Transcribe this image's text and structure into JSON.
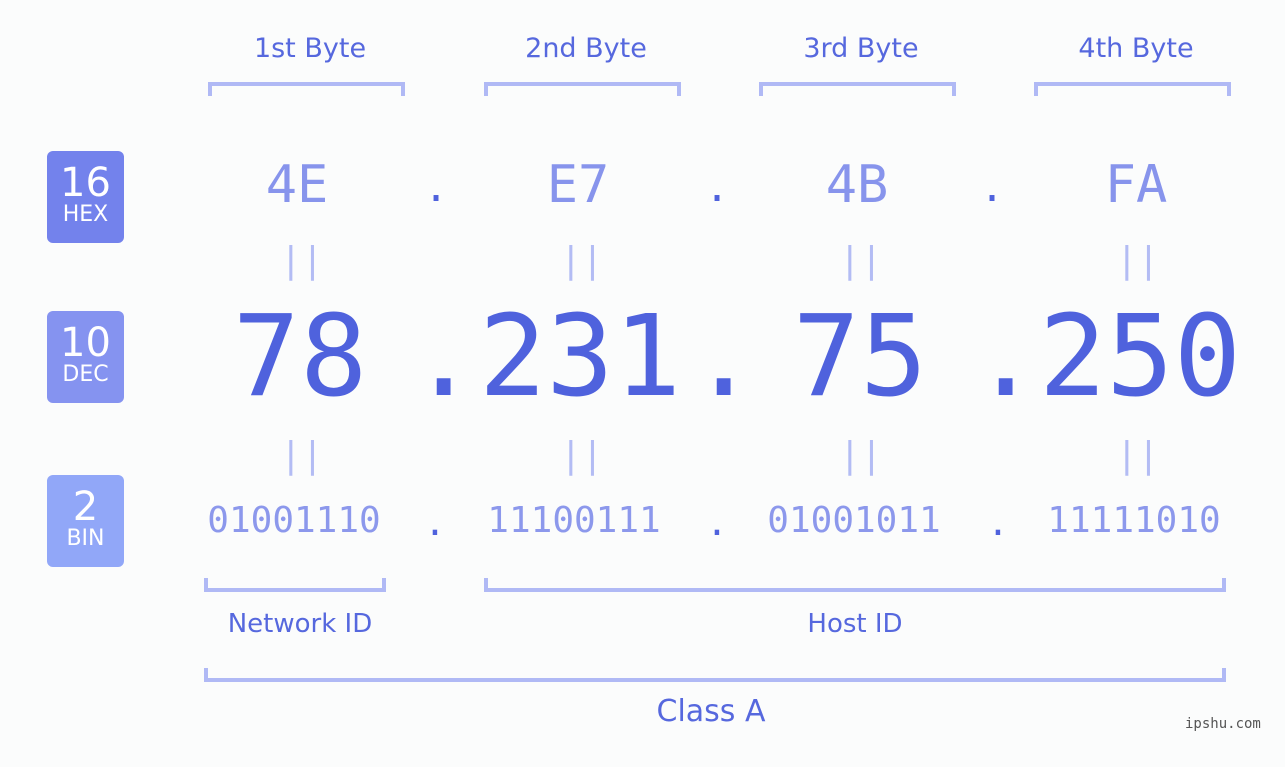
{
  "badges": [
    {
      "num": "16",
      "label": "HEX",
      "color": "#7382ec"
    },
    {
      "num": "10",
      "label": "DEC",
      "color": "#8593f0"
    },
    {
      "num": "2",
      "label": "BIN",
      "color": "#91a7f8"
    }
  ],
  "bytes": [
    {
      "label": "1st Byte",
      "hex": "4E",
      "dec": "78",
      "bin": "01001110"
    },
    {
      "label": "2nd Byte",
      "hex": "E7",
      "dec": "231",
      "bin": "11100111"
    },
    {
      "label": "3rd Byte",
      "hex": "4B",
      "dec": "75",
      "bin": "01001011"
    },
    {
      "label": "4th Byte",
      "hex": "FA",
      "dec": "250",
      "bin": "11111010"
    }
  ],
  "separator": ".",
  "equals": "||",
  "segments": {
    "network": "Network ID",
    "host": "Host ID",
    "class": "Class A"
  },
  "watermark": "ipshu.com"
}
